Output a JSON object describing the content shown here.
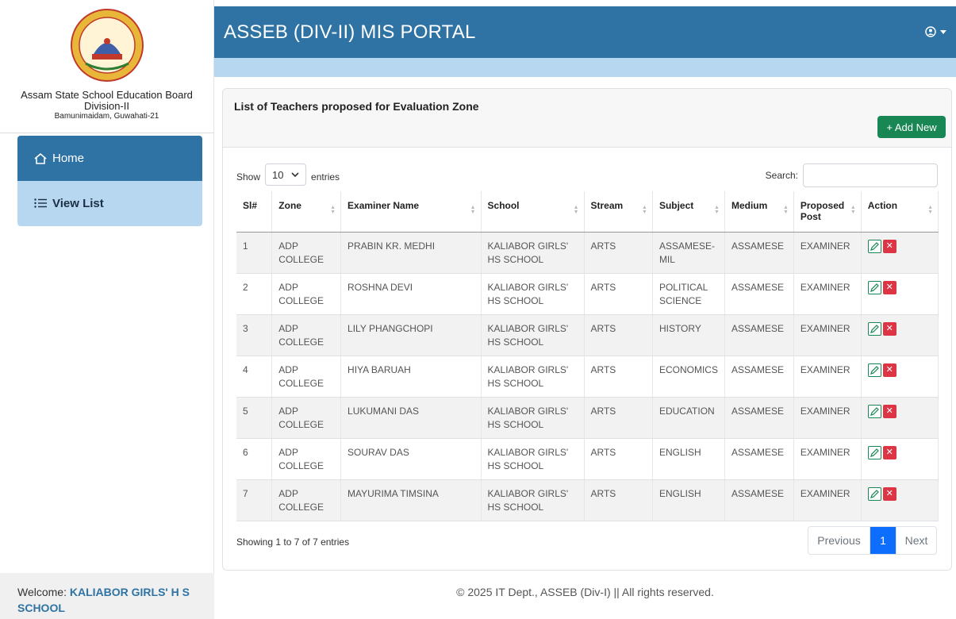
{
  "sidebar": {
    "brand_line1": "Assam State School Education Board",
    "brand_line2": "Division-II",
    "brand_line3": "Bamunimaidam, Guwahati-21",
    "menu": [
      {
        "label": "Home",
        "icon": "home-icon",
        "active": true
      },
      {
        "label": "View List",
        "icon": "list-icon",
        "active": false
      }
    ],
    "welcome_prefix": "Welcome: ",
    "welcome_name": "KALIABOR GIRLS' H S SCHOOL"
  },
  "header": {
    "title": "ASSEB (DIV-II) MIS PORTAL",
    "user_icon": "user-circle-icon"
  },
  "card": {
    "title": "List of Teachers proposed for Evaluation Zone",
    "add_button": "+ Add New"
  },
  "table_controls": {
    "show_label": "Show",
    "page_length": "10",
    "entries_label": "entries",
    "search_label": "Search:",
    "search_value": ""
  },
  "table": {
    "columns": [
      "Sl#",
      "Zone",
      "Examiner Name",
      "School",
      "Stream",
      "Subject",
      "Medium",
      "Proposed Post",
      "Action"
    ],
    "rows": [
      {
        "sl": "1",
        "zone": "ADP COLLEGE",
        "name": "PRABIN KR. MEDHI",
        "school": "KALIABOR GIRLS' HS SCHOOL",
        "stream": "ARTS",
        "subject": "ASSAMESE-MIL",
        "medium": "ASSAMESE",
        "post": "EXAMINER"
      },
      {
        "sl": "2",
        "zone": "ADP COLLEGE",
        "name": "ROSHNA DEVI",
        "school": "KALIABOR GIRLS' HS SCHOOL",
        "stream": "ARTS",
        "subject": "POLITICAL SCIENCE",
        "medium": "ASSAMESE",
        "post": "EXAMINER"
      },
      {
        "sl": "3",
        "zone": "ADP COLLEGE",
        "name": "LILY PHANGCHOPI",
        "school": "KALIABOR GIRLS' HS SCHOOL",
        "stream": "ARTS",
        "subject": "HISTORY",
        "medium": "ASSAMESE",
        "post": "EXAMINER"
      },
      {
        "sl": "4",
        "zone": "ADP COLLEGE",
        "name": "HIYA BARUAH",
        "school": "KALIABOR GIRLS' HS SCHOOL",
        "stream": "ARTS",
        "subject": "ECONOMICS",
        "medium": "ASSAMESE",
        "post": "EXAMINER"
      },
      {
        "sl": "5",
        "zone": "ADP COLLEGE",
        "name": "LUKUMANI DAS",
        "school": "KALIABOR GIRLS' HS SCHOOL",
        "stream": "ARTS",
        "subject": "EDUCATION",
        "medium": "ASSAMESE",
        "post": "EXAMINER"
      },
      {
        "sl": "6",
        "zone": "ADP COLLEGE",
        "name": "SOURAV DAS",
        "school": "KALIABOR GIRLS' HS SCHOOL",
        "stream": "ARTS",
        "subject": "ENGLISH",
        "medium": "ASSAMESE",
        "post": "EXAMINER"
      },
      {
        "sl": "7",
        "zone": "ADP COLLEGE",
        "name": "MAYURIMA TIMSINA",
        "school": "KALIABOR GIRLS' HS SCHOOL",
        "stream": "ARTS",
        "subject": "ENGLISH",
        "medium": "ASSAMESE",
        "post": "EXAMINER"
      }
    ]
  },
  "pagination": {
    "info": "Showing 1 to 7 of 7 entries",
    "previous": "Previous",
    "current": "1",
    "next": "Next"
  },
  "footer": {
    "text": "© 2025 IT Dept., ASSEB (Div-I) || All rights reserved."
  },
  "colors": {
    "primary": "#2e73a4",
    "light": "#b6d7ef",
    "success": "#198754",
    "danger": "#dc3545",
    "page_active": "#0d6efd"
  }
}
